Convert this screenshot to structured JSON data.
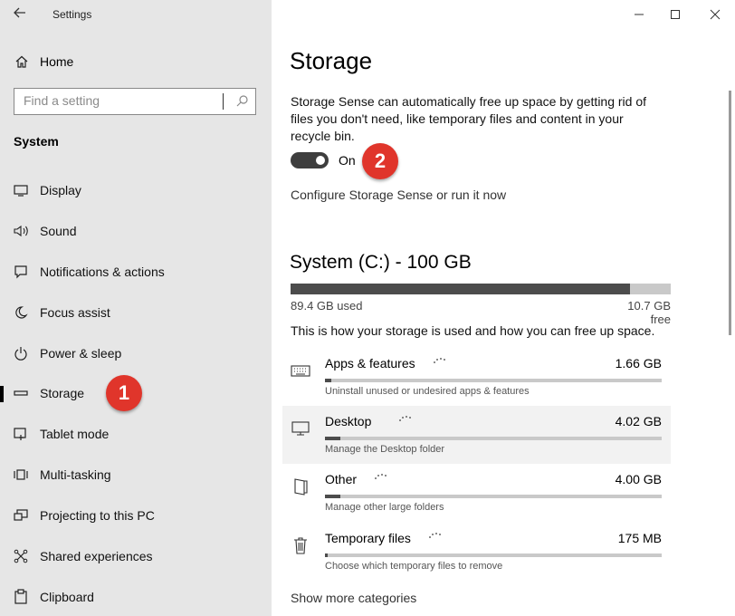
{
  "window": {
    "title": "Settings"
  },
  "sidebar": {
    "home_label": "Home",
    "search_placeholder": "Find a setting",
    "section_label": "System",
    "items": [
      {
        "label": "Display",
        "icon": "monitor-icon"
      },
      {
        "label": "Sound",
        "icon": "speaker-icon"
      },
      {
        "label": "Notifications & actions",
        "icon": "message-icon"
      },
      {
        "label": "Focus assist",
        "icon": "moon-icon"
      },
      {
        "label": "Power & sleep",
        "icon": "power-icon"
      },
      {
        "label": "Storage",
        "icon": "drive-icon",
        "selected": true
      },
      {
        "label": "Tablet mode",
        "icon": "tablet-icon"
      },
      {
        "label": "Multi-tasking",
        "icon": "multitask-icon"
      },
      {
        "label": "Projecting to this PC",
        "icon": "projector-icon"
      },
      {
        "label": "Shared experiences",
        "icon": "shared-icon"
      },
      {
        "label": "Clipboard",
        "icon": "clipboard-icon"
      }
    ]
  },
  "annotations": {
    "badge1": "1",
    "badge2": "2",
    "color": "#e0352b"
  },
  "main": {
    "title": "Storage",
    "description": "Storage Sense can automatically free up space by getting rid of files you don't need, like temporary files and content in your recycle bin.",
    "toggle_label": "On",
    "toggle_on": true,
    "configure_link": "Configure Storage Sense or run it now",
    "drive": {
      "title": "System (C:) - 100 GB",
      "used_label": "89.4 GB used",
      "free_label": "10.7 GB free",
      "used_fraction": 0.894
    },
    "info": "This is how your storage is used and how you can free up space.",
    "categories": [
      {
        "name": "Apps & features",
        "size": "1.66 GB",
        "sub": "Uninstall unused or undesired apps & features",
        "fraction": 0.02
      },
      {
        "name": "Desktop",
        "size": "4.02 GB",
        "sub": "Manage the Desktop folder",
        "fraction": 0.045
      },
      {
        "name": "Other",
        "size": "4.00 GB",
        "sub": "Manage other large folders",
        "fraction": 0.045
      },
      {
        "name": "Temporary files",
        "size": "175 MB",
        "sub": "Choose which temporary files to remove",
        "fraction": 0.003
      }
    ],
    "show_more": "Show more categories"
  }
}
